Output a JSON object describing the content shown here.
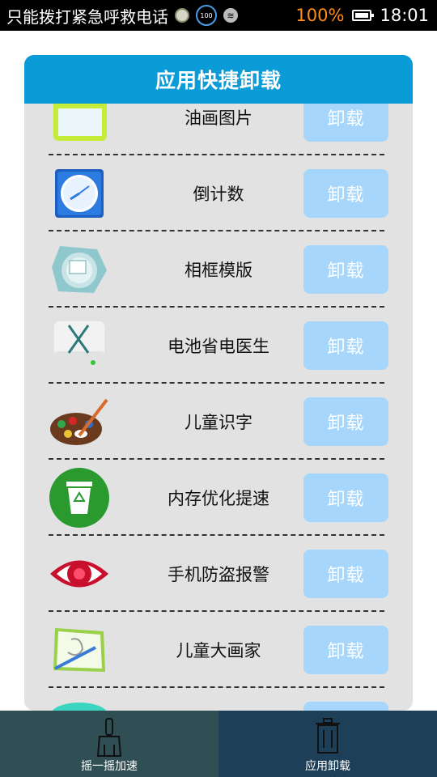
{
  "status_bar": {
    "carrier_text": "只能拨打紧急呼救电话",
    "battery_text": "100%",
    "time": "18:01",
    "icons": [
      "compass-icon",
      "battery-saver-100-icon",
      "wifi-icon",
      "battery-icon"
    ]
  },
  "card": {
    "title": "应用快捷卸载",
    "apps": [
      {
        "name": "油画图片",
        "icon": "oil-painting-app-icon",
        "button": "卸载"
      },
      {
        "name": "倒计数",
        "icon": "countdown-clock-icon",
        "button": "卸载"
      },
      {
        "name": "相框模版",
        "icon": "photo-frame-icon",
        "button": "卸载"
      },
      {
        "name": "电池省电医生",
        "icon": "battery-doctor-icon",
        "button": "卸载"
      },
      {
        "name": "儿童识字",
        "icon": "paint-palette-icon",
        "button": "卸载"
      },
      {
        "name": "内存优化提速",
        "icon": "recycle-bin-icon",
        "button": "卸载"
      },
      {
        "name": "手机防盗报警",
        "icon": "eye-alarm-icon",
        "button": "卸载"
      },
      {
        "name": "儿童大画家",
        "icon": "drawing-board-icon",
        "button": "卸载"
      },
      {
        "name": "",
        "icon": "teal-app-icon",
        "button": ""
      }
    ]
  },
  "bottom_nav": {
    "tabs": [
      {
        "label": "摇一摇加速",
        "icon": "broom-icon"
      },
      {
        "label": "应用卸载",
        "icon": "trash-icon",
        "active": true
      }
    ]
  },
  "colors": {
    "header": "#0b9bd6",
    "button": "#a6d6fb",
    "nav_left": "#2f4f55",
    "nav_right": "#1e3f58",
    "battery_text": "#ff8c1a"
  }
}
